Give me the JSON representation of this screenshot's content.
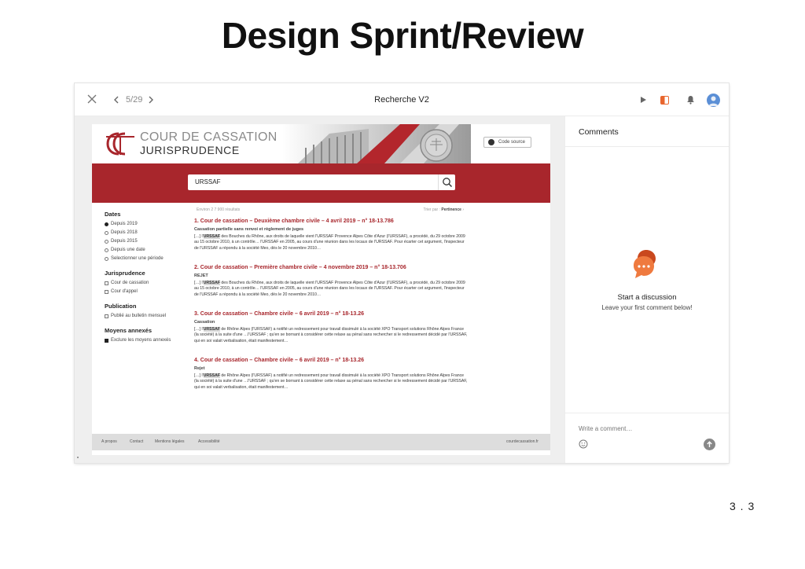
{
  "slide": {
    "title": "Design Sprint/Review",
    "number": "3 . 3"
  },
  "toolbar": {
    "pager": "5/29",
    "screen_title": "Recherche V2",
    "icons": [
      "close-icon",
      "chevron-left-icon",
      "chevron-right-icon",
      "play-icon",
      "panel-icon",
      "bell-icon",
      "avatar"
    ]
  },
  "site": {
    "logo_line1": "COUR DE CASSATION",
    "logo_line2": "JURISPRUDENCE",
    "code_button": "Code source",
    "search_value": "URSSAF",
    "results_count": "Environ 2 7 900 résultats",
    "sort_label": "Trier par :",
    "sort_value": "Pertinence",
    "filters": [
      {
        "heading": "Dates",
        "options": [
          {
            "label": "Depuis 2019",
            "type": "radio",
            "checked": true
          },
          {
            "label": "Depuis 2018",
            "type": "radio",
            "checked": false
          },
          {
            "label": "Depuis 2015",
            "type": "radio",
            "checked": false
          },
          {
            "label": "Depuis une date",
            "type": "radio",
            "checked": false
          },
          {
            "label": "Selectionner une période",
            "type": "radio",
            "checked": false
          }
        ]
      },
      {
        "heading": "Jurisprudence",
        "options": [
          {
            "label": "Cour de cassation",
            "type": "check",
            "checked": false
          },
          {
            "label": "Cour d'appel",
            "type": "check",
            "checked": false
          }
        ]
      },
      {
        "heading": "Publication",
        "options": [
          {
            "label": "Publié au bulletin mensuel",
            "type": "check",
            "checked": false
          }
        ]
      },
      {
        "heading": "Moyens annexés",
        "options": [
          {
            "label": "Exclure les moyens annexés",
            "type": "check",
            "checked": true
          }
        ]
      }
    ],
    "results": [
      {
        "title": "1. Cour de cassation – Deuxième chambre civile – 4 avril 2019 – n° 18-13.786",
        "subtitle": "Cassation partielle sans renvoi et règlement de juges",
        "pre": "[…] l'",
        "highlight": "URSSAF",
        "snippet": " des Bouches du Rhône, aux droits de laquelle vient l'URSSAF Provence Alpes Côte d'Azur (l'URSSAF), a procédé, du 29 octobre 2009 au 15 octobre 2010, à un contrôle… l'URSSAF en 2005, au cours d'une réunion dans les locaux de l'URSSAF. Pour écarter cet argument, l'inspecteur de l'URSSAF a répondu à la société Meo, dès le 20 novembre 2010…"
      },
      {
        "title": "2. Cour de cassation – Première chambre civile – 4 novembre 2019 – n° 18-13.706",
        "subtitle": "REJET",
        "pre": "[…] l'",
        "highlight": "URSSAF",
        "snippet": " des Bouches du Rhône, aux droits de laquelle vient l'URSSAF Provence Alpes Côte d'Azur (l'URSSAF), a procédé, du 29 octobre 2009 au 15 octobre 2010, à un contrôle… l'URSSAF en 2005, au cours d'une réunion dans les locaux de l'URSSAF. Pour écarter cet argument, l'inspecteur de l'URSSAF a répondu à la société Meo, dès le 20 novembre 2010…"
      },
      {
        "title": "3. Cour de cassation – Chambre civile – 6 avril 2019 – n° 18-13.26",
        "subtitle": "Cassation",
        "pre": "[…] l'",
        "highlight": "URSSAF",
        "snippet": " de Rhône Alpes (l'URSSAF) a notifié un redressement pour travail dissimulé à la société XPO Transport solutions Rhône Alpes France (la société) à la suite d'une …l'URSSAF ; qu'en se bornant à considérer cette relaxe au pénal sans rechercher si le redressement décidé par l'URSSAF, qui en soi valait verbalisation, était manifestement…"
      },
      {
        "title": "4. Cour de cassation – Chambre civile – 6 avril 2019 – n° 18-13.26",
        "subtitle": "Rejet",
        "pre": "[…] l'",
        "highlight": "URSSAF",
        "snippet": " de Rhône Alpes (l'URSSAF) a notifié un redressement pour travail dissimulé à la société XPO Transport solutions Rhône Alpes France (la société) à la suite d'une …l'URSSAF ; qu'en se bornant à considérer cette relaxe au pénal sans rechercher si le redressement décidé par l'URSSAF, qui en soi valait verbalisation, était manifestement…"
      }
    ],
    "footer": {
      "about": "A propos",
      "contact": "Contact",
      "legal": "Mentions légales",
      "accessibility": "Accessibilité",
      "domain": "courdecassation.fr"
    }
  },
  "comments": {
    "title": "Comments",
    "start": "Start a discussion",
    "sub": "Leave your first comment below!",
    "placeholder": "Write a comment…"
  },
  "colors": {
    "brand_red": "#a8262c",
    "bubble_orange": "#e8662e"
  }
}
